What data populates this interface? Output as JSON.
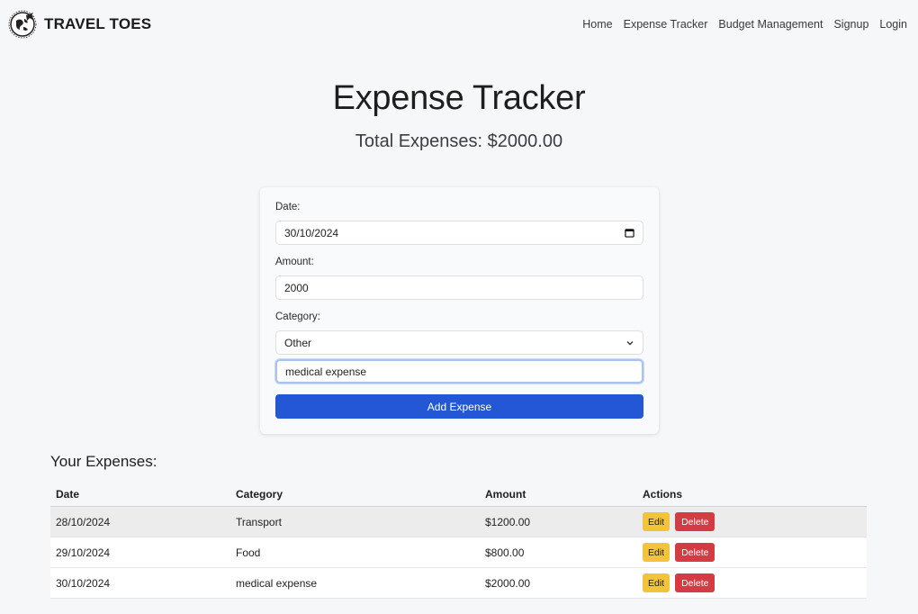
{
  "brand": {
    "name": "TRAVEL TOES",
    "logo_icon": "globe-plane-logo-icon"
  },
  "nav": [
    "Home",
    "Expense Tracker",
    "Budget Management",
    "Signup",
    "Login"
  ],
  "page": {
    "title": "Expense Tracker",
    "total": "Total Expenses: $2000.00"
  },
  "form": {
    "date_label": "Date:",
    "date_value": "30/10/2024",
    "amount_label": "Amount:",
    "amount_value": "2000",
    "category_label": "Category:",
    "category_selected": "Other",
    "custom_category_value": "medical expense",
    "submit_label": "Add Expense"
  },
  "expenses": {
    "heading": "Your Expenses:",
    "columns": [
      "Date",
      "Category",
      "Amount",
      "Actions"
    ],
    "rows": [
      {
        "date": "28/10/2024",
        "category": "Transport",
        "amount": "$1200.00",
        "edit": "Edit",
        "delete": "Delete"
      },
      {
        "date": "29/10/2024",
        "category": "Food",
        "amount": "$800.00",
        "edit": "Edit",
        "delete": "Delete"
      },
      {
        "date": "30/10/2024",
        "category": "medical expense",
        "amount": "$2000.00",
        "edit": "Edit",
        "delete": "Delete"
      }
    ]
  },
  "colors": {
    "primary": "#2357d6",
    "edit": "#f3c43a",
    "delete": "#d43c44",
    "background": "#f6f7f9"
  }
}
